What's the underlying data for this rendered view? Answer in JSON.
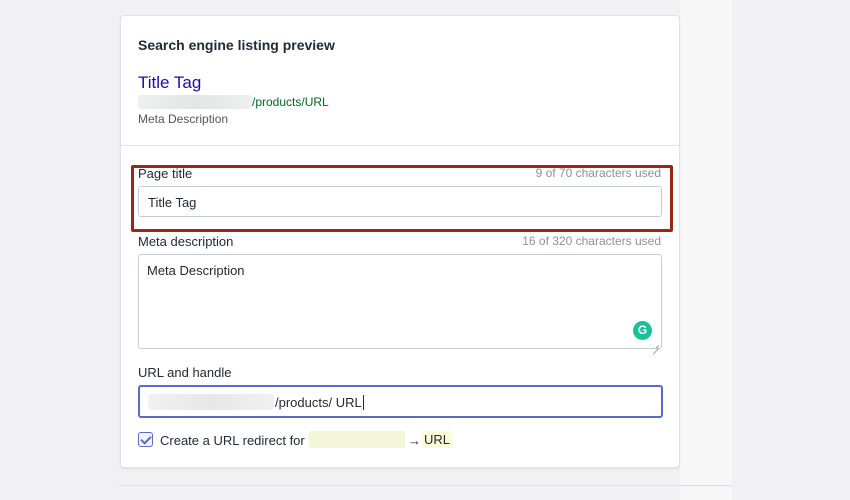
{
  "section_title": "Search engine listing preview",
  "preview": {
    "title": "Title Tag",
    "url": "/products/URL",
    "description": "Meta Description"
  },
  "page_title_field": {
    "label": "Page title",
    "counter": "9 of 70 characters used",
    "value": "Title Tag"
  },
  "meta_description_field": {
    "label": "Meta description",
    "counter": "16 of 320 characters used",
    "value": "Meta Description"
  },
  "url_field": {
    "label": "URL and handle",
    "value": "/products/ URL"
  },
  "redirect": {
    "checked": true,
    "label": "Create a URL redirect for",
    "arrow": "→",
    "target": "URL"
  },
  "colors": {
    "highlight_border": "#98271a",
    "preview_title": "#1a0dab",
    "preview_url": "#006621",
    "focus_border": "#5c6ac4",
    "grammarly": "#15c39a"
  },
  "icons": {
    "grammarly": "grammarly-icon",
    "checkbox": "checkmark-icon",
    "resize": "resize-handle-icon"
  }
}
